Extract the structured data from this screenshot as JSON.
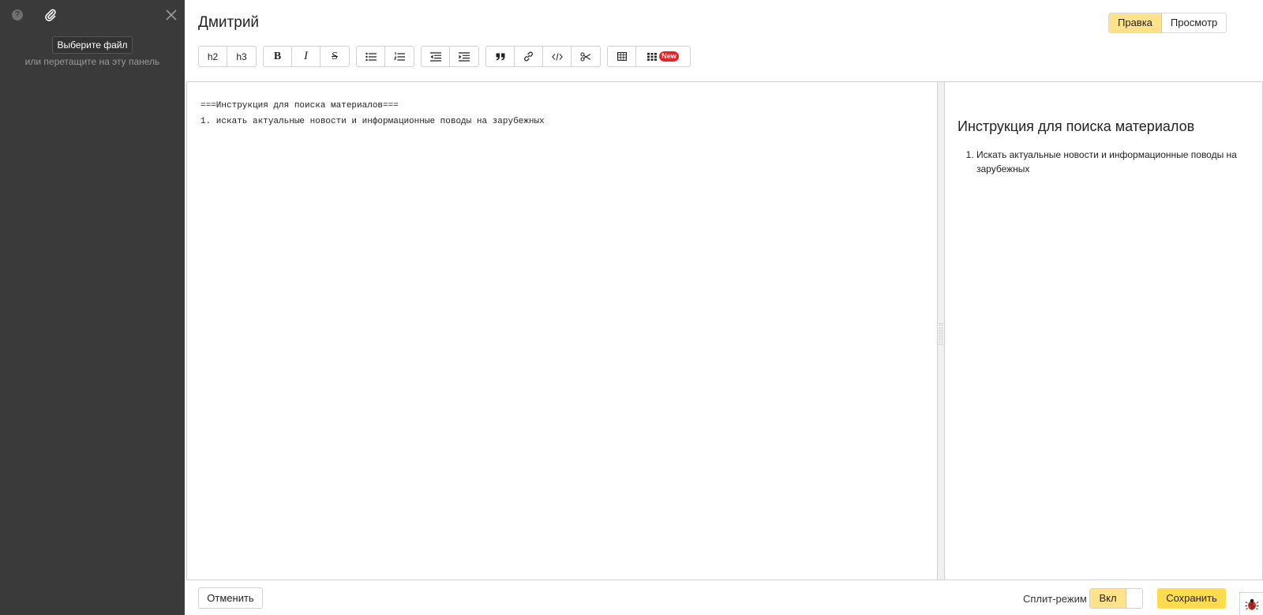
{
  "sidebar": {
    "file_button": "Выберите файл",
    "hint": "или перетащите на эту панель",
    "help_glyph": "?"
  },
  "header": {
    "title": "Дмитрий",
    "modes": [
      "Правка",
      "Просмотр"
    ],
    "active_mode": "Правка"
  },
  "toolbar": {
    "h2": "h2",
    "h3": "h3",
    "bold": "B",
    "italic": "I",
    "strike": "S",
    "new_badge": "New"
  },
  "editor": {
    "lines": [
      "===Инструкция для поиска материалов===",
      "1. искать актуальные новости и информационные поводы на зарубежных"
    ]
  },
  "preview": {
    "heading": "Инструкция для поиска материалов",
    "items": [
      "Искать актуальные новости и информационные поводы на зарубежных"
    ]
  },
  "footer": {
    "cancel": "Отменить",
    "split_label": "Сплит-режим",
    "split_state": "Вкл",
    "save": "Сохранить"
  },
  "colors": {
    "sidebar_bg": "#3a3a3a",
    "accent_yellow": "#ffdb4d",
    "active_tab": "#ffe28a",
    "new_badge": "#e8242a"
  }
}
